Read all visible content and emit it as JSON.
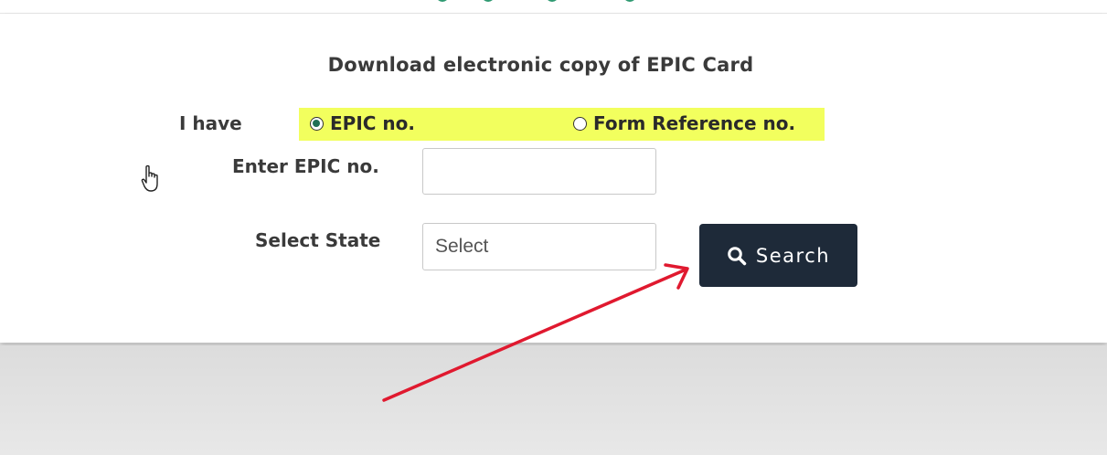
{
  "form": {
    "title": "Download electronic copy of EPIC Card",
    "i_have_label": "I have",
    "options": [
      {
        "label": "EPIC no.",
        "checked": true
      },
      {
        "label": "Form Reference no.",
        "checked": false
      }
    ],
    "epic_label": "Enter EPIC no.",
    "epic_value": "",
    "state_label": "Select State",
    "state_selected": "Select",
    "search_label": "Search"
  },
  "colors": {
    "highlight": "#f2ff5e",
    "button_bg": "#1e2a39",
    "arrow": "#e0192f",
    "radio_checked": "#1f6f55"
  },
  "icons": [
    "search-icon",
    "hand-cursor-icon",
    "annotation-arrow"
  ]
}
